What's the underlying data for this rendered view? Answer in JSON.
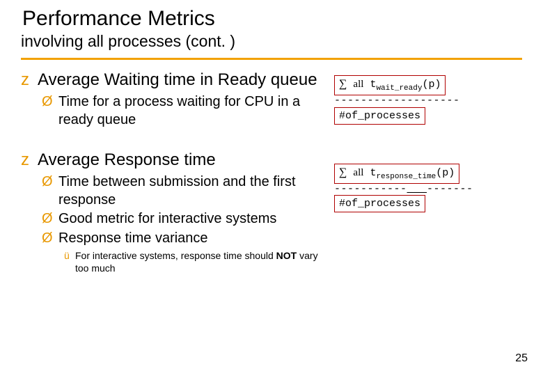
{
  "title": "Performance Metrics",
  "subtitle": "involving all processes (cont. )",
  "bullets": {
    "z": "z",
    "arrow": "Ø",
    "check": "ü"
  },
  "section1": {
    "heading": "Average Waiting time in Ready queue",
    "sub1": "Time for a process waiting for CPU in a ready queue"
  },
  "section2": {
    "heading": "Average Response time",
    "sub1": "Time between submission and the first response",
    "sub2": "Good metric for interactive systems",
    "sub3": "Response time variance",
    "note_a": "For interactive systems, response time should ",
    "note_b": "NOT",
    "note_c": " vary too much"
  },
  "formula1": {
    "sigma": "∑",
    "all": "all",
    "var": "t",
    "sub": "wait_ready",
    "arg": "(p)",
    "dashes": "-------------------",
    "denom": "#of_processes"
  },
  "formula2": {
    "sigma": "∑",
    "all": "all",
    "var": "t",
    "sub": "response_time",
    "arg": "(p)",
    "dash_a": "-----------",
    "dash_b": "___",
    "dash_c": "-------",
    "denom": "#of_processes"
  },
  "page_number": "25"
}
